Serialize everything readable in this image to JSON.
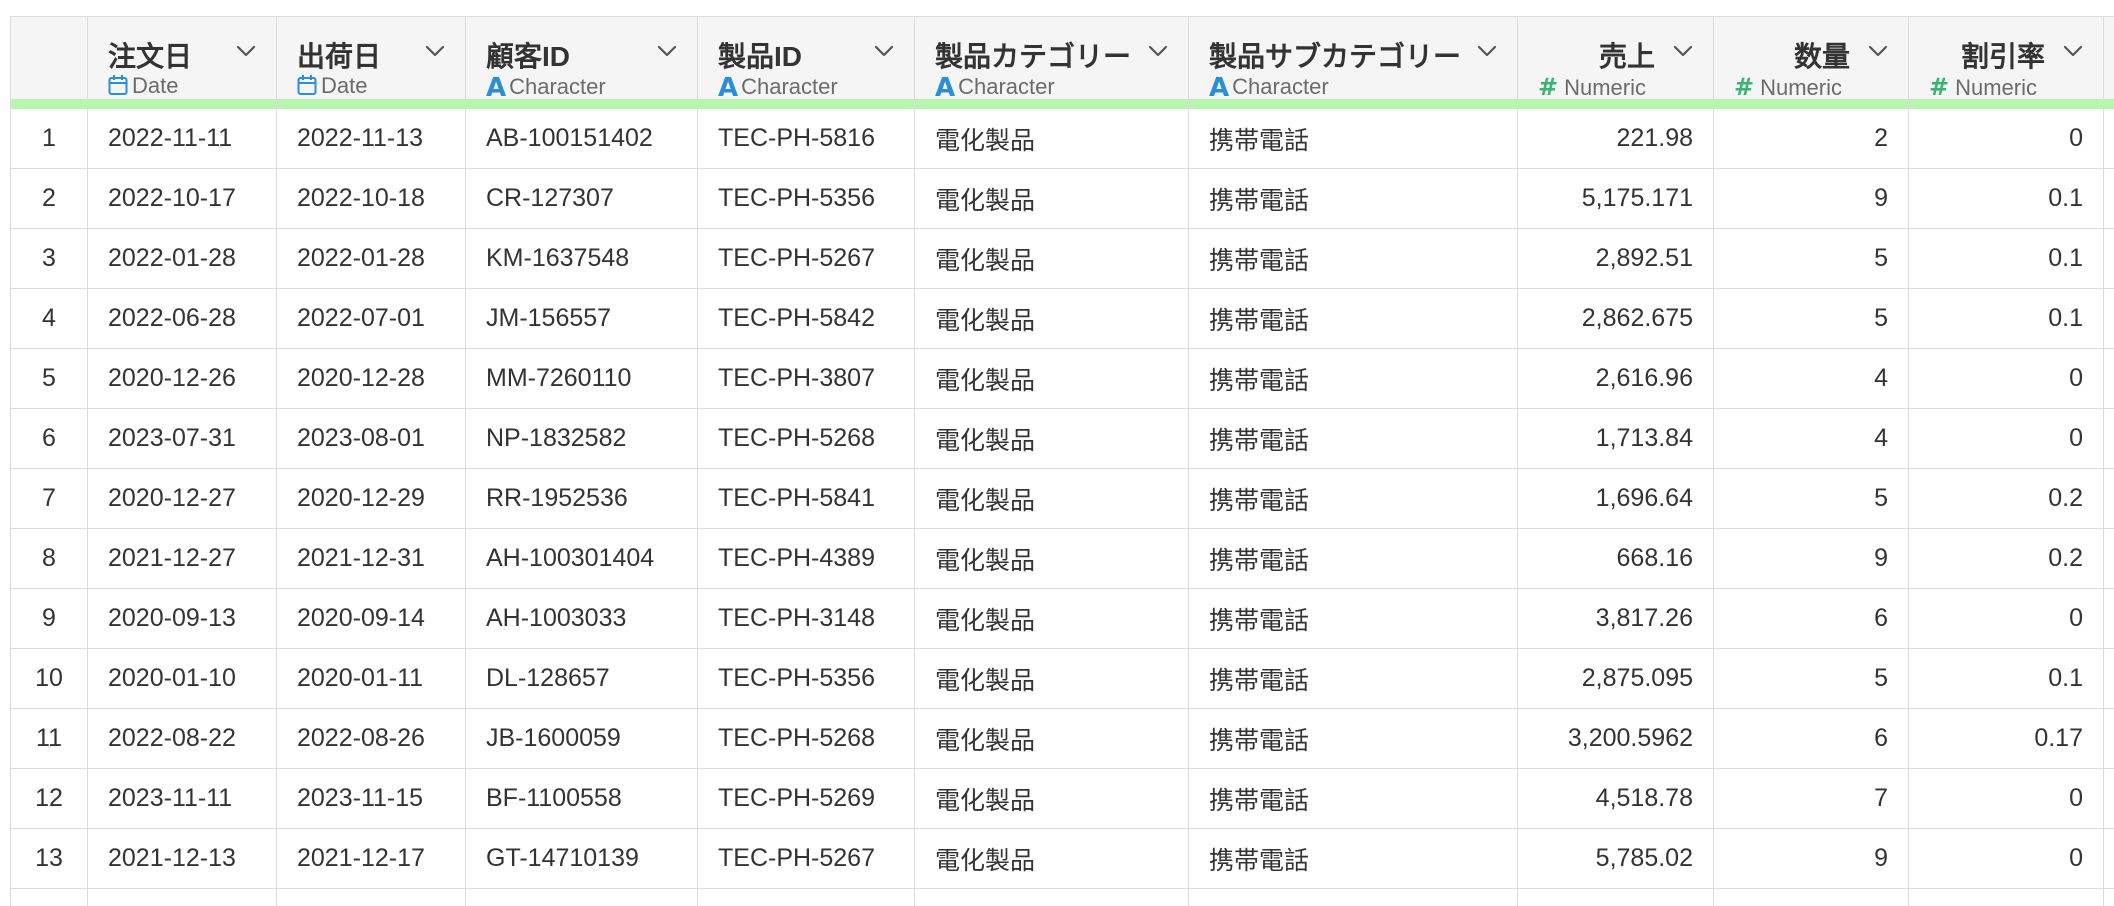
{
  "columns": [
    {
      "name": "注文日",
      "type_label": "Date",
      "type_icon": "calendar-icon",
      "align": "left"
    },
    {
      "name": "出荷日",
      "type_label": "Date",
      "type_icon": "calendar-icon",
      "align": "left"
    },
    {
      "name": "顧客ID",
      "type_label": "Character",
      "type_icon": "character-type-icon",
      "align": "left"
    },
    {
      "name": "製品ID",
      "type_label": "Character",
      "type_icon": "character-type-icon",
      "align": "left"
    },
    {
      "name": "製品カテゴリー",
      "type_label": "Character",
      "type_icon": "character-type-icon",
      "align": "left"
    },
    {
      "name": "製品サブカテゴリー",
      "type_label": "Character",
      "type_icon": "character-type-icon",
      "align": "left"
    },
    {
      "name": "売上",
      "type_label": "Numeric",
      "type_icon": "numeric-type-icon",
      "align": "right"
    },
    {
      "name": "数量",
      "type_label": "Numeric",
      "type_icon": "numeric-type-icon",
      "align": "right"
    },
    {
      "name": "割引率",
      "type_label": "Numeric",
      "type_icon": "numeric-type-icon",
      "align": "right"
    }
  ],
  "rows": [
    {
      "index": "1",
      "cells": [
        "2022-11-11",
        "2022-11-13",
        "AB-100151402",
        "TEC-PH-5816",
        "電化製品",
        "携帯電話",
        "221.98",
        "2",
        "0"
      ]
    },
    {
      "index": "2",
      "cells": [
        "2022-10-17",
        "2022-10-18",
        "CR-127307",
        "TEC-PH-5356",
        "電化製品",
        "携帯電話",
        "5,175.171",
        "9",
        "0.1"
      ]
    },
    {
      "index": "3",
      "cells": [
        "2022-01-28",
        "2022-01-28",
        "KM-1637548",
        "TEC-PH-5267",
        "電化製品",
        "携帯電話",
        "2,892.51",
        "5",
        "0.1"
      ]
    },
    {
      "index": "4",
      "cells": [
        "2022-06-28",
        "2022-07-01",
        "JM-156557",
        "TEC-PH-5842",
        "電化製品",
        "携帯電話",
        "2,862.675",
        "5",
        "0.1"
      ]
    },
    {
      "index": "5",
      "cells": [
        "2020-12-26",
        "2020-12-28",
        "MM-7260110",
        "TEC-PH-3807",
        "電化製品",
        "携帯電話",
        "2,616.96",
        "4",
        "0"
      ]
    },
    {
      "index": "6",
      "cells": [
        "2023-07-31",
        "2023-08-01",
        "NP-1832582",
        "TEC-PH-5268",
        "電化製品",
        "携帯電話",
        "1,713.84",
        "4",
        "0"
      ]
    },
    {
      "index": "7",
      "cells": [
        "2020-12-27",
        "2020-12-29",
        "RR-1952536",
        "TEC-PH-5841",
        "電化製品",
        "携帯電話",
        "1,696.64",
        "5",
        "0.2"
      ]
    },
    {
      "index": "8",
      "cells": [
        "2021-12-27",
        "2021-12-31",
        "AH-100301404",
        "TEC-PH-4389",
        "電化製品",
        "携帯電話",
        "668.16",
        "9",
        "0.2"
      ]
    },
    {
      "index": "9",
      "cells": [
        "2020-09-13",
        "2020-09-14",
        "AH-1003033",
        "TEC-PH-3148",
        "電化製品",
        "携帯電話",
        "3,817.26",
        "6",
        "0"
      ]
    },
    {
      "index": "10",
      "cells": [
        "2020-01-10",
        "2020-01-11",
        "DL-128657",
        "TEC-PH-5356",
        "電化製品",
        "携帯電話",
        "2,875.095",
        "5",
        "0.1"
      ]
    },
    {
      "index": "11",
      "cells": [
        "2022-08-22",
        "2022-08-26",
        "JB-1600059",
        "TEC-PH-5268",
        "電化製品",
        "携帯電話",
        "3,200.5962",
        "6",
        "0.17"
      ]
    },
    {
      "index": "12",
      "cells": [
        "2023-11-11",
        "2023-11-15",
        "BF-1100558",
        "TEC-PH-5269",
        "電化製品",
        "携帯電話",
        "4,518.78",
        "7",
        "0"
      ]
    },
    {
      "index": "13",
      "cells": [
        "2021-12-13",
        "2021-12-17",
        "GT-14710139",
        "TEC-PH-5267",
        "電化製品",
        "携帯電話",
        "5,785.02",
        "9",
        "0"
      ]
    }
  ],
  "colors": {
    "header_bg": "#f5f5f5",
    "quality_bar": "#b9f5b0",
    "date_icon": "#2a8fd8",
    "character_icon": "#2a8fd8",
    "numeric_icon": "#3cb371"
  }
}
